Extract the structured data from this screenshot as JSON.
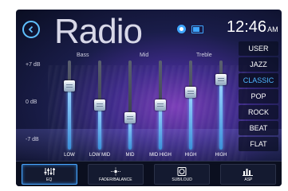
{
  "header": {
    "title": "Radio",
    "time": "12:46",
    "ampm": "AM"
  },
  "eq": {
    "db_labels": [
      "+7 dB",
      "0 dB",
      "-7 dB"
    ],
    "band_groups": [
      "Bass",
      "Mid",
      "Treble"
    ],
    "sliders": [
      {
        "label": "LOW",
        "value_db": 3
      },
      {
        "label": "LOW MID",
        "value_db": 0
      },
      {
        "label": "MID",
        "value_db": -2
      },
      {
        "label": "MID HIGH",
        "value_db": 0
      },
      {
        "label": "HIGH",
        "value_db": 2
      },
      {
        "label": "HIGH",
        "value_db": 4
      }
    ]
  },
  "presets": {
    "items": [
      "USER",
      "JAZZ",
      "CLASSIC",
      "POP",
      "ROCK",
      "BEAT",
      "FLAT"
    ],
    "selected": "CLASSIC"
  },
  "bottom_nav": {
    "items": [
      {
        "label": "EQ",
        "icon": "eq-icon",
        "active": true
      },
      {
        "label": "FADER/BALANCE",
        "icon": "fader-balance-icon",
        "active": false
      },
      {
        "label": "SUB/LOUD",
        "icon": "subwoofer-icon",
        "active": false
      },
      {
        "label": "ASP",
        "icon": "bars-icon",
        "active": false
      }
    ]
  },
  "colors": {
    "accent": "#4fb6ff",
    "background_dark": "#0a0e22",
    "purple_glow": "#7a3db8"
  }
}
